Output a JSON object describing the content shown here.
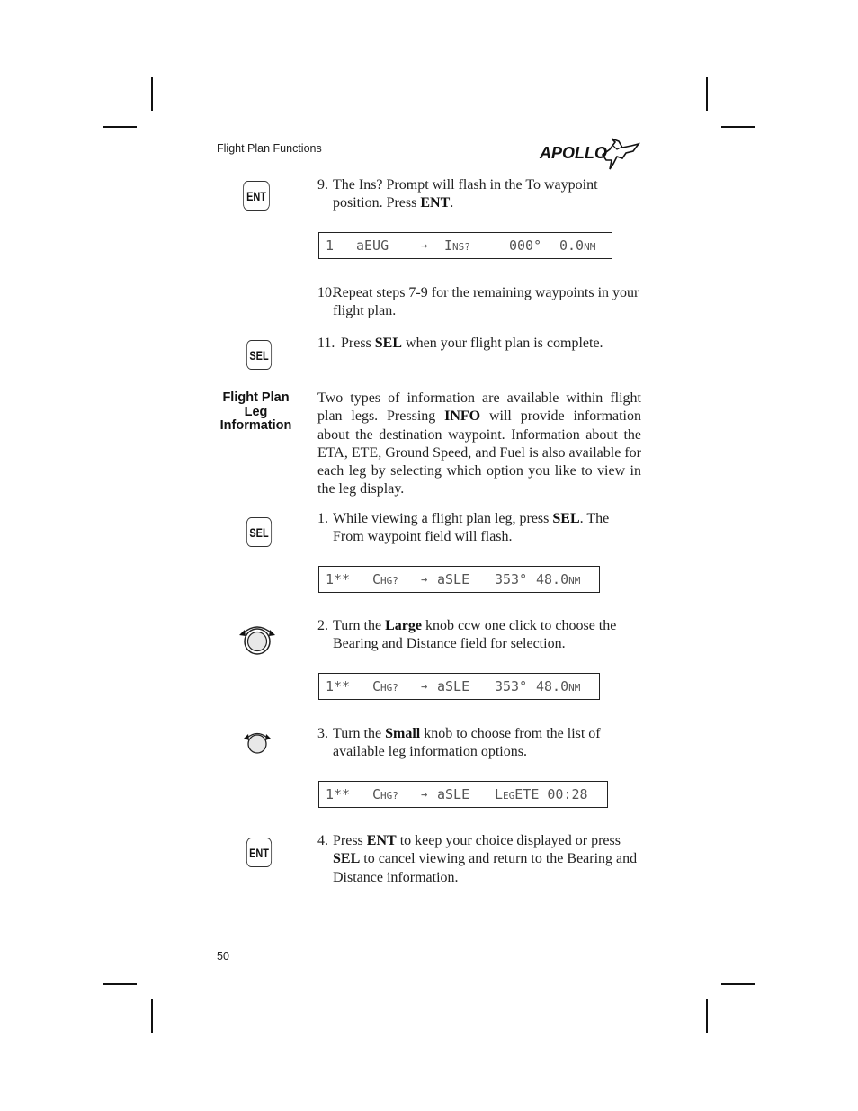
{
  "header": {
    "section_title": "Flight Plan Functions",
    "logo_text": "APOLLO"
  },
  "keys": {
    "ent": "ENT",
    "sel": "SEL"
  },
  "steps_top": [
    {
      "num": "9.",
      "pre": "The Ins? Prompt will flash in the To waypoint position. Press ",
      "bold": "ENT",
      "post": "."
    },
    {
      "num": "10.",
      "text": "Repeat steps 7-9 for the remaining waypoints in your flight plan."
    },
    {
      "num": "11.",
      "pre": "Press ",
      "bold": "SEL",
      "post": " when your flight plan is complete."
    }
  ],
  "lcd_1": {
    "index": "1",
    "from": "aEUG",
    "arrow": "→",
    "to_prefix": "I",
    "to_sc": "NS?",
    "bearing": "000°",
    "distance": "0.0",
    "unit": "NM"
  },
  "section": {
    "heading_lines": [
      "Flight Plan",
      "Leg",
      "Information"
    ],
    "para_pre": "Two types of information are available within flight plan legs. Pressing ",
    "para_bold": "INFO",
    "para_post": " will provide information about the destination waypoint. Information about the ETA, ETE, Ground Speed, and Fuel is also available for each leg by selecting which option you like to view in the leg display."
  },
  "steps_bottom": [
    {
      "num": "1.",
      "pre": "While viewing a flight plan leg, press ",
      "bold": "SEL",
      "post": ". The From waypoint field will flash."
    },
    {
      "num": "2.",
      "pre": "Turn the ",
      "bold": "Large",
      "post": " knob ccw one click to choose the Bearing and Distance field for selection."
    },
    {
      "num": "3.",
      "pre": "Turn the ",
      "bold": "Small",
      "post": " knob to choose from the list of available leg information options."
    },
    {
      "num": "4.",
      "pre": "Press ",
      "bold": "ENT",
      "mid": " to keep your choice displayed or press ",
      "bold2": "SEL",
      "post": " to cancel viewing and return to the Bearing and Distance information."
    }
  ],
  "lcd_2": {
    "index": "1**",
    "from_prefix": "C",
    "from_sc": "HG?",
    "arrow": "→",
    "to": "aSLE",
    "bearing": "353°",
    "distance": "48.0",
    "unit": "NM"
  },
  "lcd_3": {
    "index": "1**",
    "from_prefix": "C",
    "from_sc": "HG?",
    "arrow": "→",
    "to": "aSLE",
    "bearing": "353",
    "deg": "°",
    "distance": "48.0",
    "unit": "NM"
  },
  "lcd_4": {
    "index": "1**",
    "from_prefix": "C",
    "from_sc": "HG?",
    "arrow": "→",
    "to": "aSLE",
    "info_prefix": "L",
    "info_sc": "EG",
    "info_rest": "ETE 00:28"
  },
  "footer": {
    "page_number": "50"
  }
}
